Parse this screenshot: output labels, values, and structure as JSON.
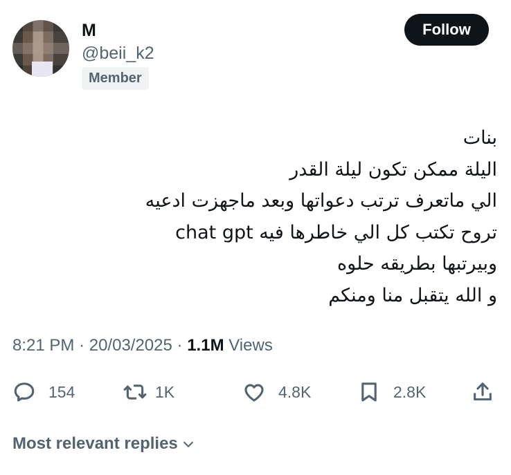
{
  "author": {
    "display_name": "M",
    "handle": "@beii_k2",
    "badge": "Member"
  },
  "follow_button": {
    "label": "Follow"
  },
  "tweet": {
    "lines": [
      "بنات",
      "اليلة ممكن تكون ليلة القدر",
      "الي ماتعرف ترتب دعواتها وبعد ماجهزت ادعيه",
      "تروح تكتب كل الي خاطرها فيه  chat gpt",
      "وبيرتبها بطريقه حلوه",
      "و الله يتقبل منا ومنكم"
    ]
  },
  "meta": {
    "time": "8:21 PM",
    "separator": "·",
    "date": "20/03/2025",
    "views_count": "1.1M",
    "views_label": "Views"
  },
  "actions": {
    "replies": {
      "icon": "reply-icon",
      "count": "154"
    },
    "reposts": {
      "icon": "repost-icon",
      "count": "1K"
    },
    "likes": {
      "icon": "heart-icon",
      "count": "4.8K"
    },
    "bookmarks": {
      "icon": "bookmark-icon",
      "count": "2.8K"
    },
    "share": {
      "icon": "share-icon"
    }
  },
  "replies_sort": {
    "label": "Most relevant replies",
    "icon": "chevron-down-icon"
  }
}
